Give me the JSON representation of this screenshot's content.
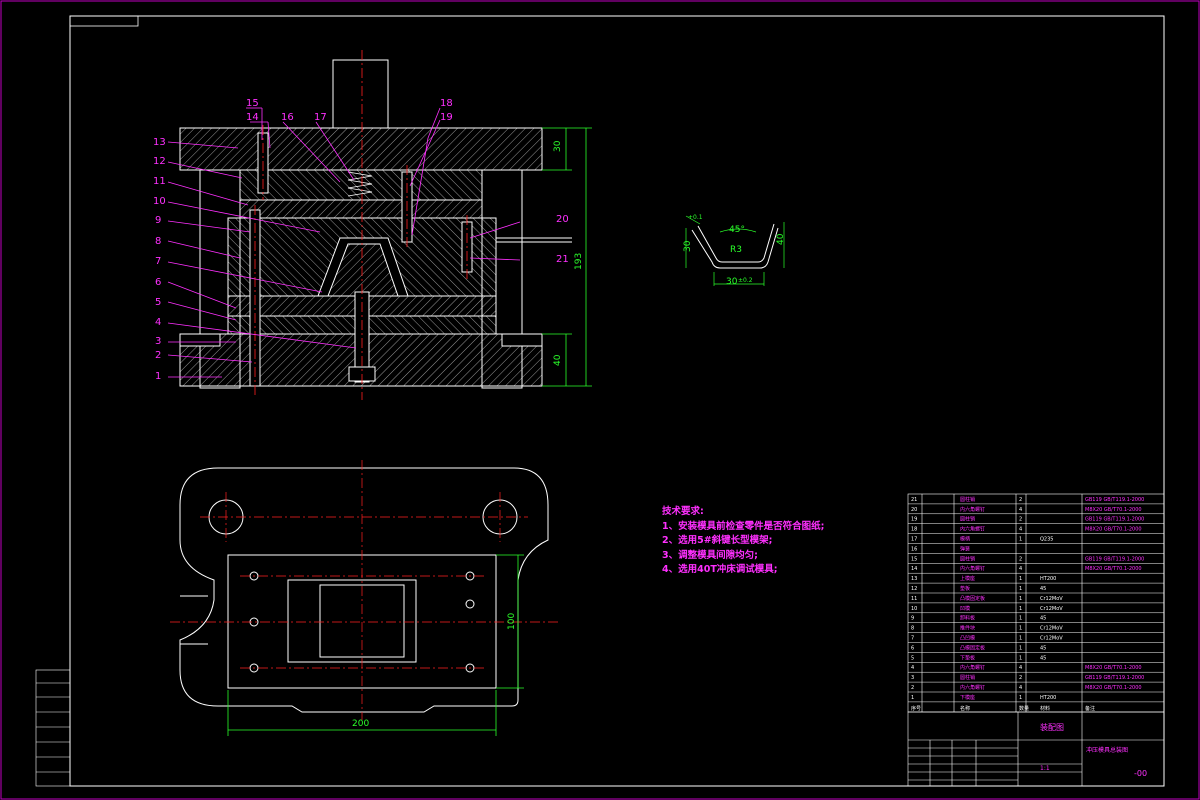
{
  "drawing": {
    "frame_color": "#c000c0",
    "line_color": "#ffffff",
    "dim_color": "#2aff2a",
    "center_line_color": "#ff2020",
    "callout_color": "#ff30ff",
    "hatch_color": "#ffffff"
  },
  "part_labels": [
    "1",
    "2",
    "3",
    "4",
    "5",
    "6",
    "7",
    "8",
    "9",
    "10",
    "11",
    "12",
    "13",
    "14",
    "15",
    "16",
    "17",
    "18",
    "19",
    "20",
    "21"
  ],
  "dimensions": {
    "top_plate_thickness": "30",
    "total_height": "193",
    "bottom_plate_thickness": "40",
    "base_width": "200",
    "base_depth": "100",
    "part_height_left": "30",
    "part_height_right": "40",
    "part_bottom_width": "30",
    "part_angle": "45°",
    "part_radius": "R3",
    "part_tolerance": "+0.1",
    "part_bottom_tol": "±0.2"
  },
  "tech_requirements": {
    "title": "技术要求:",
    "items": [
      "1、安装模具前检查零件是否符合图纸;",
      "2、选用5#斜键长型模架;",
      "3、调整模具间隙均匀;",
      "4、选用40T冲床调试模具;"
    ]
  },
  "bom": {
    "rows": [
      {
        "no": "21",
        "name": "圆柱销",
        "qty": "2",
        "material": "",
        "std": "GB119 GB/T119.1-2000"
      },
      {
        "no": "20",
        "name": "内六角螺钉",
        "qty": "4",
        "material": "",
        "std": "M8X20 GB/T70.1-2000"
      },
      {
        "no": "19",
        "name": "圆柱销",
        "qty": "2",
        "material": "",
        "std": "GB119 GB/T119.1-2000"
      },
      {
        "no": "18",
        "name": "内六角螺钉",
        "qty": "4",
        "material": "",
        "std": "M8X20 GB/T70.1-2000"
      },
      {
        "no": "17",
        "name": "模柄",
        "qty": "1",
        "material": "Q235",
        "std": ""
      },
      {
        "no": "16",
        "name": "弹簧",
        "qty": "",
        "material": "",
        "std": ""
      },
      {
        "no": "15",
        "name": "圆柱销",
        "qty": "2",
        "material": "",
        "std": "GB119 GB/T119.1-2000"
      },
      {
        "no": "14",
        "name": "内六角螺钉",
        "qty": "4",
        "material": "",
        "std": "M8X20 GB/T70.1-2000"
      },
      {
        "no": "13",
        "name": "上模座",
        "qty": "1",
        "material": "HT200",
        "std": ""
      },
      {
        "no": "12",
        "name": "垫板",
        "qty": "1",
        "material": "45",
        "std": ""
      },
      {
        "no": "11",
        "name": "凸模固定板",
        "qty": "1",
        "material": "Cr12MoV",
        "std": ""
      },
      {
        "no": "10",
        "name": "凹模",
        "qty": "1",
        "material": "Cr12MoV",
        "std": ""
      },
      {
        "no": "9",
        "name": "卸料板",
        "qty": "1",
        "material": "45",
        "std": ""
      },
      {
        "no": "8",
        "name": "推件块",
        "qty": "1",
        "material": "Cr12MoV",
        "std": ""
      },
      {
        "no": "7",
        "name": "凸凹模",
        "qty": "1",
        "material": "Cr12MoV",
        "std": ""
      },
      {
        "no": "6",
        "name": "凸模固定板",
        "qty": "1",
        "material": "45",
        "std": ""
      },
      {
        "no": "5",
        "name": "下垫板",
        "qty": "1",
        "material": "45",
        "std": ""
      },
      {
        "no": "4",
        "name": "内六角螺钉",
        "qty": "4",
        "material": "",
        "std": "M8X20 GB/T70.1-2000"
      },
      {
        "no": "3",
        "name": "圆柱销",
        "qty": "2",
        "material": "",
        "std": "GB119 GB/T119.1-2000"
      },
      {
        "no": "2",
        "name": "内六角螺钉",
        "qty": "4",
        "material": "",
        "std": "M8X20 GB/T70.1-2000"
      },
      {
        "no": "1",
        "name": "下模座",
        "qty": "1",
        "material": "HT200",
        "std": ""
      }
    ],
    "header": {
      "no": "序号",
      "name": "名称",
      "qty": "数量",
      "material": "材料",
      "std": "备注"
    }
  },
  "title_block": {
    "drawing_title": "装配图",
    "sub_title": "冲压模具总装图",
    "scale": "1:1",
    "sheet_no": "-00"
  }
}
